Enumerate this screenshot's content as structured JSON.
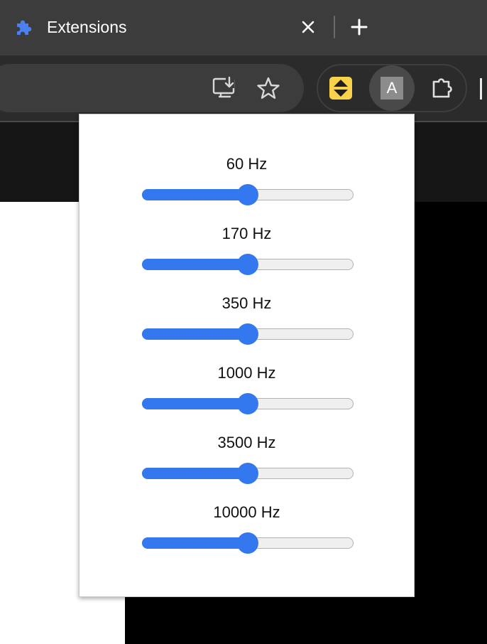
{
  "tab": {
    "title": "Extensions",
    "favicon_icon": "puzzle-piece-icon",
    "close_icon": "close-icon",
    "new_tab_icon": "plus-icon"
  },
  "toolbar": {
    "install_icon": "install-app-icon",
    "bookmark_icon": "star-icon",
    "extensions": [
      {
        "icon": "yellow-up-down-arrows-icon",
        "active": false
      },
      {
        "icon": "letter-a-icon",
        "label": "A",
        "active": true
      },
      {
        "icon": "puzzle-piece-outline-icon",
        "active": false
      }
    ]
  },
  "equalizer": {
    "bands": [
      {
        "label": "60 Hz",
        "value": 0.5
      },
      {
        "label": "170 Hz",
        "value": 0.5
      },
      {
        "label": "350 Hz",
        "value": 0.5
      },
      {
        "label": "1000 Hz",
        "value": 0.5
      },
      {
        "label": "3500 Hz",
        "value": 0.5
      },
      {
        "label": "10000 Hz",
        "value": 0.5
      }
    ]
  },
  "colors": {
    "accent": "#3478f0",
    "favicon": "#4a80f0",
    "extension_yellow": "#f8d24a"
  }
}
